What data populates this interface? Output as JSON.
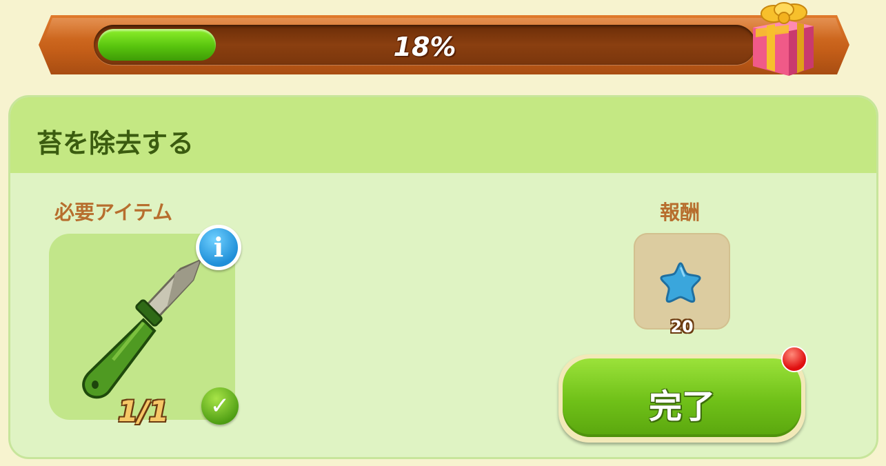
{
  "progress": {
    "percent": 18,
    "label": "18%",
    "reward_icon": "gift-box-icon"
  },
  "task": {
    "title": "苔を除去する",
    "required_items_label": "必要アイテム",
    "reward_label": "報酬",
    "required_item": {
      "icon": "knife-icon",
      "count_text": "1/1",
      "fulfilled": true
    },
    "reward": {
      "icon": "blue-star-icon",
      "amount": "20"
    },
    "complete_label": "完了",
    "has_notification": true
  },
  "colors": {
    "progress_fill": "#58c40e",
    "bar_frame": "#c45e18",
    "panel_header": "#c4e883",
    "panel_body": "#dff3c3",
    "button_green": "#6fc018",
    "notification_red": "#e01010"
  }
}
